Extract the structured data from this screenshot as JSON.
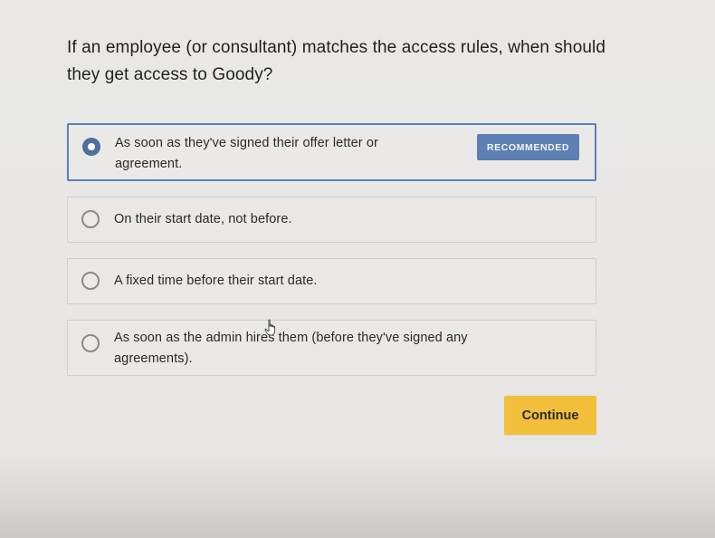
{
  "question": {
    "text": "If an employee (or consultant) matches the access rules, when should they get access to Goody?"
  },
  "options": [
    {
      "label": "As soon as they've signed their offer letter or agreement.",
      "selected": true,
      "badge": "RECOMMENDED"
    },
    {
      "label": "On their start date, not before.",
      "selected": false
    },
    {
      "label": "A fixed time before their start date.",
      "selected": false
    },
    {
      "label": "As soon as the admin hires them (before they've signed any agreements).",
      "selected": false
    }
  ],
  "actions": {
    "continue_label": "Continue"
  },
  "colors": {
    "accent": "#5d7fb3",
    "radio_selected": "#4e6e9f",
    "continue_button": "#f2bf3b",
    "background": "#e8e7e5"
  },
  "icons": {
    "cursor": "hand-pointer-icon"
  }
}
